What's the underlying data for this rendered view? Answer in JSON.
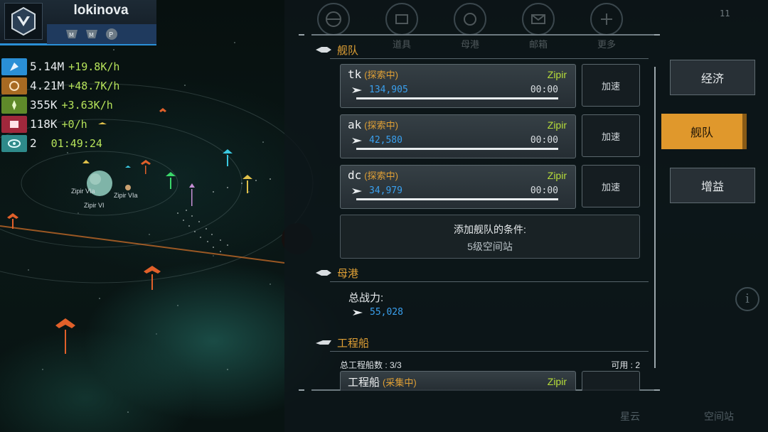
{
  "player": {
    "name": "lokinova",
    "badges": [
      "rank-m-badge",
      "rank-m-badge-2",
      "p-badge"
    ]
  },
  "resources": [
    {
      "icon": "crystal-icon",
      "amount": "5.14M",
      "rate": "+19.8K/h",
      "color": "#2a8fd6"
    },
    {
      "icon": "ore-icon",
      "amount": "4.21M",
      "rate": "+48.7K/h",
      "color": "#a86a22"
    },
    {
      "icon": "gas-icon",
      "amount": "355K",
      "rate": "+3.63K/h",
      "color": "#5f8a2a"
    },
    {
      "icon": "cargo-icon",
      "amount": "118K",
      "rate": "+0/h",
      "color": "#a0283c"
    },
    {
      "icon": "eye-icon",
      "amount": "2",
      "time": "01:49:24",
      "color": "#2e8a8a"
    }
  ],
  "map": {
    "planet_labels": [
      "Zipir VIa",
      "Zipir VIa",
      "Zipir VI"
    ]
  },
  "top_nav": [
    {
      "label": "",
      "icon": "globe-icon"
    },
    {
      "label": "道具",
      "icon": "items-icon"
    },
    {
      "label": "母港",
      "icon": "home-port-icon"
    },
    {
      "label": "邮箱",
      "icon": "mail-icon"
    },
    {
      "label": "更多",
      "icon": "more-icon"
    }
  ],
  "corner_count": "11",
  "fleet_section": {
    "title": "舰队",
    "fleets": [
      {
        "name": "tk",
        "status": "(探索中)",
        "location": "Zipir",
        "power": "134,905",
        "timer": "00:00",
        "speed_label": "加速"
      },
      {
        "name": "ak",
        "status": "(探索中)",
        "location": "Zipir",
        "power": "42,580",
        "timer": "00:00",
        "speed_label": "加速"
      },
      {
        "name": "dc",
        "status": "(探索中)",
        "location": "Zipir",
        "power": "34,979",
        "timer": "00:00",
        "speed_label": "加速"
      }
    ],
    "add_fleet": {
      "title": "添加舰队的条件:",
      "condition": "5级空间站"
    }
  },
  "home_port_section": {
    "title": "母港",
    "total_power_label": "总战力:",
    "total_power": "55,028"
  },
  "engineering_section": {
    "title": "工程船",
    "count": "总工程船数 : 3/3",
    "available": "可用 : 2",
    "ship": {
      "name": "工程船",
      "status": "(采集中)",
      "location": "Zipir"
    }
  },
  "side_tabs": [
    {
      "label": "经济",
      "active": false
    },
    {
      "label": "舰队",
      "active": true
    },
    {
      "label": "增益",
      "active": false
    }
  ],
  "bottom_nav": [
    "星云",
    "空间站"
  ],
  "colors": {
    "accent": "#e0982c",
    "power_blue": "#3aa0ee",
    "location_green": "#b8de3a",
    "rate_green": "#b6e35a"
  }
}
